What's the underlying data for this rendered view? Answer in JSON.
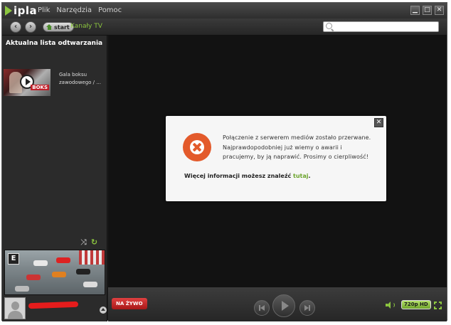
{
  "app": {
    "logo_text": "ipla"
  },
  "menu": {
    "items": [
      "Plik",
      "Narzędzia",
      "Pomoc"
    ]
  },
  "window_controls": {
    "minimize": "▁",
    "maximize": "□",
    "close": "✕"
  },
  "nav": {
    "back_icon": "‹",
    "forward_icon": "›",
    "start_label": "start",
    "breadcrumb": "Kanały TV",
    "search_placeholder": ""
  },
  "sidebar": {
    "title": "Aktualna lista odtwarzania",
    "playlist": [
      {
        "title": "Gala boksu zawodowego / ...",
        "badge": "BOKS"
      }
    ],
    "shuffle_icon": "⤨",
    "repeat_icon": "↻",
    "preview_channel_logo": "E"
  },
  "dialog": {
    "close_label": "✕",
    "message": "Połączenie z serwerem mediów zostało przerwane. Najprawdopodobniej już wiemy o awarii i pracujemy, by ją naprawić. Prosimy o cierpliwość!",
    "more_info_prefix": "Więcej informacji możesz znaleźć ",
    "more_info_link": "tutaj",
    "more_info_suffix": "."
  },
  "controls": {
    "live_label": "NA ŻYWO",
    "quality_label": "720p HD"
  },
  "colors": {
    "accent": "#8cc63f",
    "error": "#e35a2b",
    "live": "#c82020"
  }
}
